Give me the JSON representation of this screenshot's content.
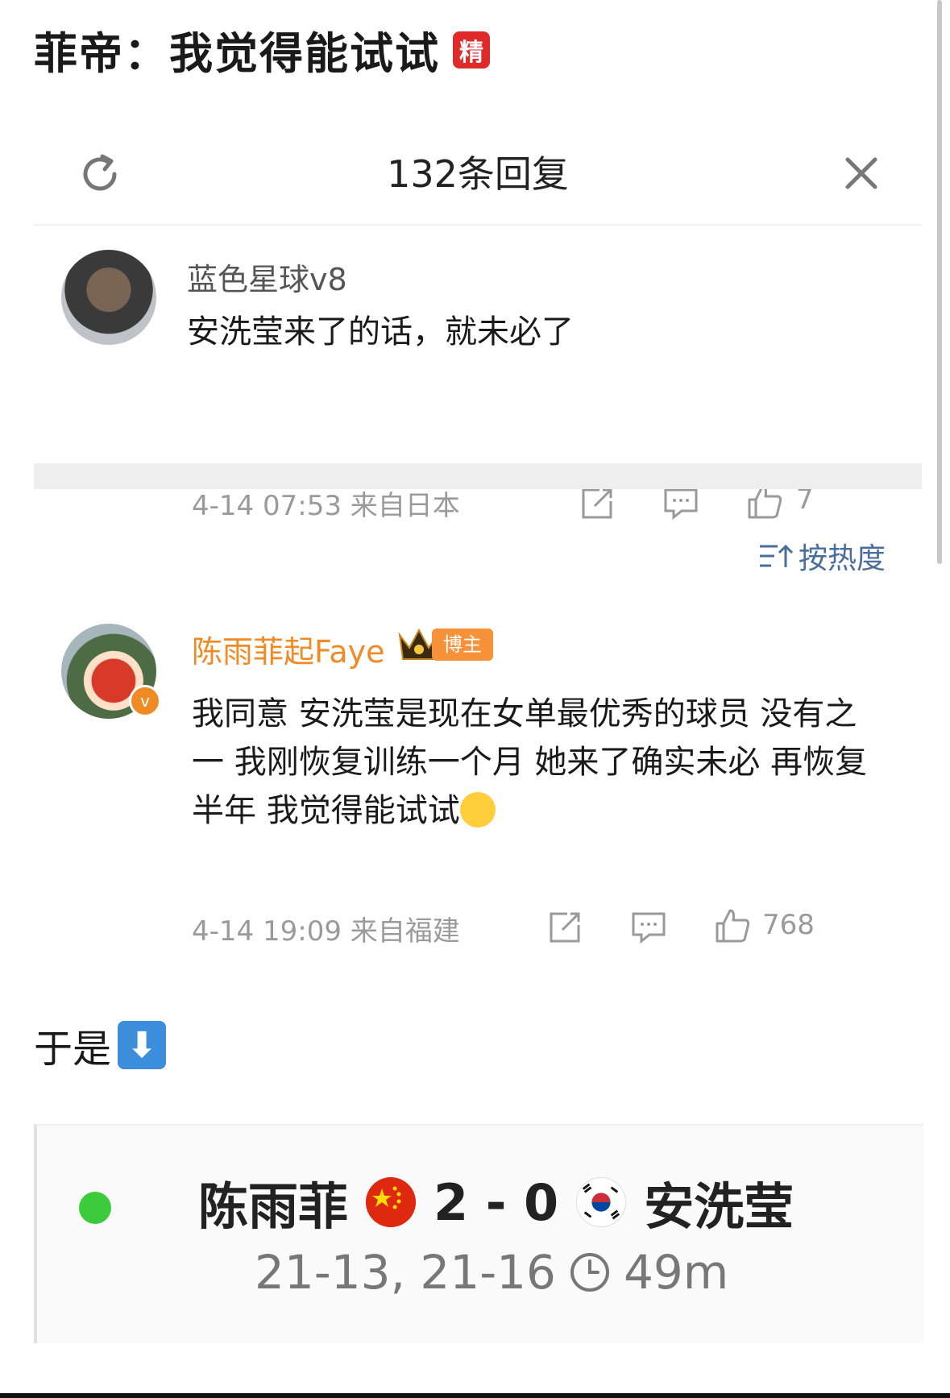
{
  "post": {
    "title": "菲帝：我觉得能试试",
    "badge": "精"
  },
  "panel": {
    "reply_count": "132条回复"
  },
  "comments": [
    {
      "username": "蓝色星球v8",
      "text": "安洗莹来了的话，就未必了",
      "meta": "4-14 07:53 来自日本",
      "likes": "7"
    },
    {
      "username": "陈雨菲起Faye",
      "role_badge": "博主",
      "text": "我同意 安洗莹是现在女单最优秀的球员 没有之一 我刚恢复训练一个月 她来了确实未必 再恢复半年 我觉得能试试",
      "meta": "4-14 19:09 来自福建",
      "likes": "768",
      "verified": "v"
    }
  ],
  "sort": {
    "label": "按热度"
  },
  "transition_text": "于是",
  "arrow_emoji": "⬇",
  "match": {
    "player_a": "陈雨菲",
    "player_b": "安洗莹",
    "score": "2 - 0",
    "sets": "21-13, 21-16",
    "duration": "49m",
    "status_color": "#3bcb3b"
  },
  "colors": {
    "accent_orange": "#f08a24",
    "sort_blue": "#4a6e9c",
    "badge_red": "#e02a2a"
  }
}
